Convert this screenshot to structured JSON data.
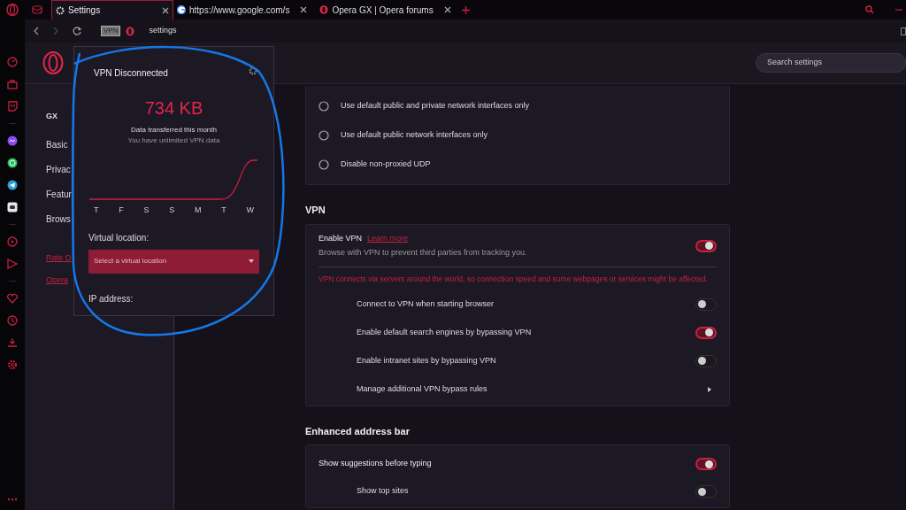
{
  "tabs": [
    {
      "kind": "settings",
      "title": "Settings",
      "selected": true
    },
    {
      "kind": "web",
      "title": "https://www.google.com/s",
      "selected": false
    },
    {
      "kind": "forum",
      "title": "Opera GX | Opera forums",
      "selected": false
    }
  ],
  "address_bar": {
    "vpn_badge": "VPN",
    "url": "settings"
  },
  "settings_search": {
    "placeholder": "Search settings"
  },
  "nav": {
    "items": [
      {
        "label": "GX",
        "selected": false
      },
      {
        "label": "Basic",
        "selected": false
      },
      {
        "label": "Privac",
        "selected": false
      },
      {
        "label": "Featur",
        "selected": false
      },
      {
        "label": "Brows",
        "selected": false
      }
    ],
    "links": [
      "Rate O",
      "Opera"
    ]
  },
  "vpn_popup": {
    "status": "VPN Disconnected",
    "amount": "734 KB",
    "caption": "Data transferred this month",
    "note": "You have unlimited VPN data",
    "days": [
      "T",
      "F",
      "S",
      "S",
      "M",
      "T",
      "W"
    ],
    "location_label": "Virtual location:",
    "location_placeholder": "Select a virtual location",
    "ip_label": "IP address:"
  },
  "sections": [
    {
      "rows": [
        {
          "kind": "radio",
          "label": "Use default public and private network interfaces only",
          "selected": false
        },
        {
          "kind": "radio",
          "label": "Use default public network interfaces only",
          "selected": false
        },
        {
          "kind": "radio",
          "label": "Disable non-proxied UDP",
          "selected": false
        }
      ]
    },
    {
      "heading": "VPN",
      "rows": [
        {
          "kind": "toggle_main",
          "label": "Enable VPN",
          "link": "Learn more",
          "description": "Browse with VPN to prevent third parties from tracking you.",
          "on": true
        },
        {
          "kind": "warning",
          "label": "VPN connects via servers around the world, so connection speed and some webpages or services might be affected."
        },
        {
          "kind": "toggle_sub",
          "label": "Connect to VPN when starting browser",
          "on": false
        },
        {
          "kind": "toggle_sub",
          "label": "Enable default search engines by bypassing VPN",
          "on": true
        },
        {
          "kind": "toggle_sub",
          "label": "Enable intranet sites by bypassing VPN",
          "on": false
        },
        {
          "kind": "link_sub",
          "label": "Manage additional VPN bypass rules"
        }
      ]
    },
    {
      "heading": "Enhanced address bar",
      "rows": [
        {
          "kind": "toggle_main",
          "label": "Show suggestions before typing",
          "on": true
        },
        {
          "kind": "toggle_sub",
          "label": "Show top sites",
          "on": false
        }
      ]
    }
  ]
}
